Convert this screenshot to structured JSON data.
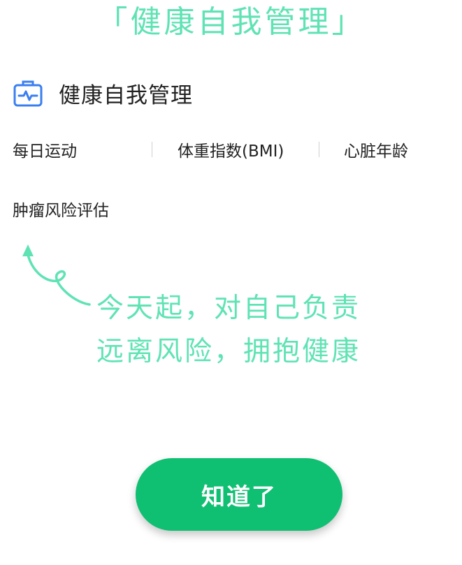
{
  "banner": {
    "title": "「健康自我管理」"
  },
  "section": {
    "title": "健康自我管理",
    "icon": "medical-kit-icon",
    "accent_color": "#3a7ff0"
  },
  "items": [
    {
      "label": "每日运动"
    },
    {
      "label": "体重指数(BMI)"
    },
    {
      "label": "心脏年龄"
    },
    {
      "label": "肿瘤风险评估"
    }
  ],
  "hint": {
    "line1": "今天起，对自己负责",
    "line2": "远离风险，拥抱健康",
    "color": "#5fe3b4"
  },
  "confirm_button": {
    "label": "知道了",
    "color": "#0fbf72"
  }
}
